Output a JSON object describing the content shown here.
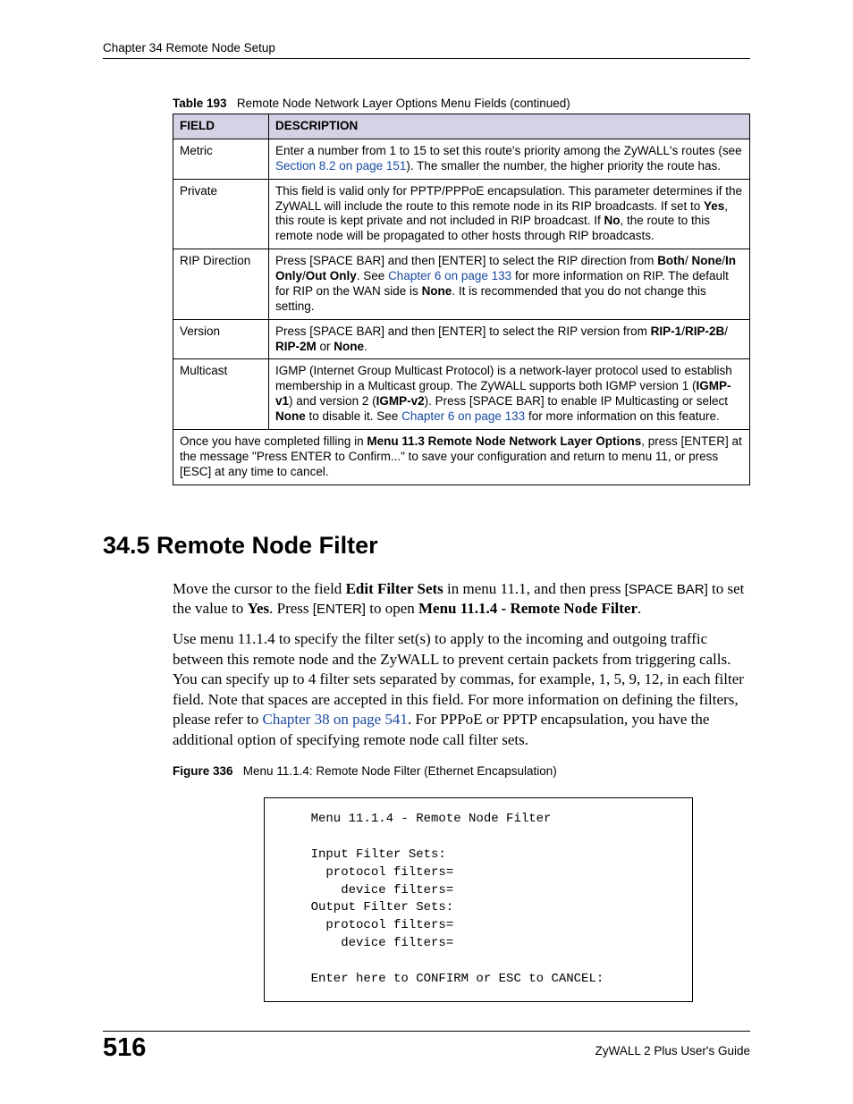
{
  "chapter_header": "Chapter 34 Remote Node Setup",
  "table": {
    "caption_label": "Table 193",
    "caption_text": "Remote Node Network Layer Options Menu Fields (continued)",
    "headers": {
      "field": "FIELD",
      "description": "DESCRIPTION"
    },
    "rows": {
      "metric": {
        "field": "Metric",
        "d1": "Enter a number from 1 to 15 to set this route's priority among the ZyWALL's routes (see ",
        "link": "Section 8.2 on page 151",
        "d2": "). The smaller the number, the higher priority the route has."
      },
      "private": {
        "field": "Private",
        "d1": "This field is valid only for PPTP/PPPoE encapsulation. This parameter determines if the ZyWALL will include the route to this remote node in its RIP broadcasts. If set to ",
        "b1": "Yes",
        "d2": ", this route is kept private and not included in RIP broadcast. If ",
        "b2": "No",
        "d3": ", the route to this remote node will be propagated to other hosts through RIP broadcasts."
      },
      "rip_direction": {
        "field": "RIP Direction",
        "d1": "Press [SPACE BAR] and then [ENTER] to select the RIP direction from ",
        "b1": "Both",
        "d2": "/ ",
        "b2": "None",
        "d3": "/",
        "b3": "In Only",
        "d4": "/",
        "b4": "Out Only",
        "d5": ". See ",
        "link": "Chapter 6 on page 133",
        "d6": " for more information on RIP. The default for RIP on the WAN side is ",
        "b5": "None",
        "d7": ". It is recommended that you do not change this setting."
      },
      "version": {
        "field": "Version",
        "d1": "Press [SPACE BAR] and then [ENTER] to select the RIP version from ",
        "b1": "RIP-1",
        "d2": "/",
        "b2": "RIP-2B",
        "d3": "/ ",
        "b3": "RIP-2M",
        "d4": " or ",
        "b4": "None",
        "d5": "."
      },
      "multicast": {
        "field": "Multicast",
        "d1": "IGMP (Internet Group Multicast Protocol) is a network-layer protocol used to establish membership in a Multicast group. The ZyWALL supports both IGMP version 1 (",
        "b1": "IGMP-v1",
        "d2": ") and version 2 (",
        "b2": "IGMP-v2",
        "d3": "). Press [SPACE BAR] to enable IP Multicasting or select ",
        "b3": "None",
        "d4": " to disable it. See ",
        "link": "Chapter 6 on page 133",
        "d5": " for more information on this feature."
      },
      "footer": {
        "d1": "Once you have completed filling in ",
        "b1": "Menu 11.3 Remote Node Network Layer Options",
        "d2": ", press [ENTER] at the message \"Press ENTER to Confirm...\" to save your configuration and return to menu 11, or press [ESC] at any time to cancel."
      }
    }
  },
  "section": {
    "heading": "34.5  Remote Node Filter",
    "para1": {
      "t1": "Move the cursor to the field ",
      "b1": "Edit Filter Sets",
      "t2": " in menu 11.1, and then press ",
      "sc1": "[SPACE BAR]",
      "t3": " to set the value to ",
      "b2": "Yes",
      "t4": ". Press ",
      "sc2": "[ENTER]",
      "t5": " to open ",
      "b3": "Menu 11.1.4 - Remote Node Filter",
      "t6": "."
    },
    "para2": {
      "t1": "Use menu 11.1.4 to specify the filter set(s) to apply to the incoming and outgoing traffic between this remote node and the ZyWALL to prevent certain packets from triggering calls. You can specify up to 4 filter sets separated by commas, for example, 1, 5, 9, 12, in each filter field. Note that spaces are accepted in this field. For more information on defining the filters, please refer to ",
      "link": "Chapter 38 on page 541",
      "t2": ". For PPPoE or PPTP encapsulation, you have the additional option of specifying remote node call filter sets."
    }
  },
  "figure": {
    "caption_label": "Figure 336",
    "caption_text": "Menu 11.1.4: Remote Node Filter (Ethernet Encapsulation)",
    "content": "    Menu 11.1.4 - Remote Node Filter\n\n    Input Filter Sets:\n      protocol filters=\n        device filters=\n    Output Filter Sets:\n      protocol filters=\n        device filters=\n\n    Enter here to CONFIRM or ESC to CANCEL:"
  },
  "footer": {
    "page_number": "516",
    "guide": "ZyWALL 2 Plus User's Guide"
  }
}
